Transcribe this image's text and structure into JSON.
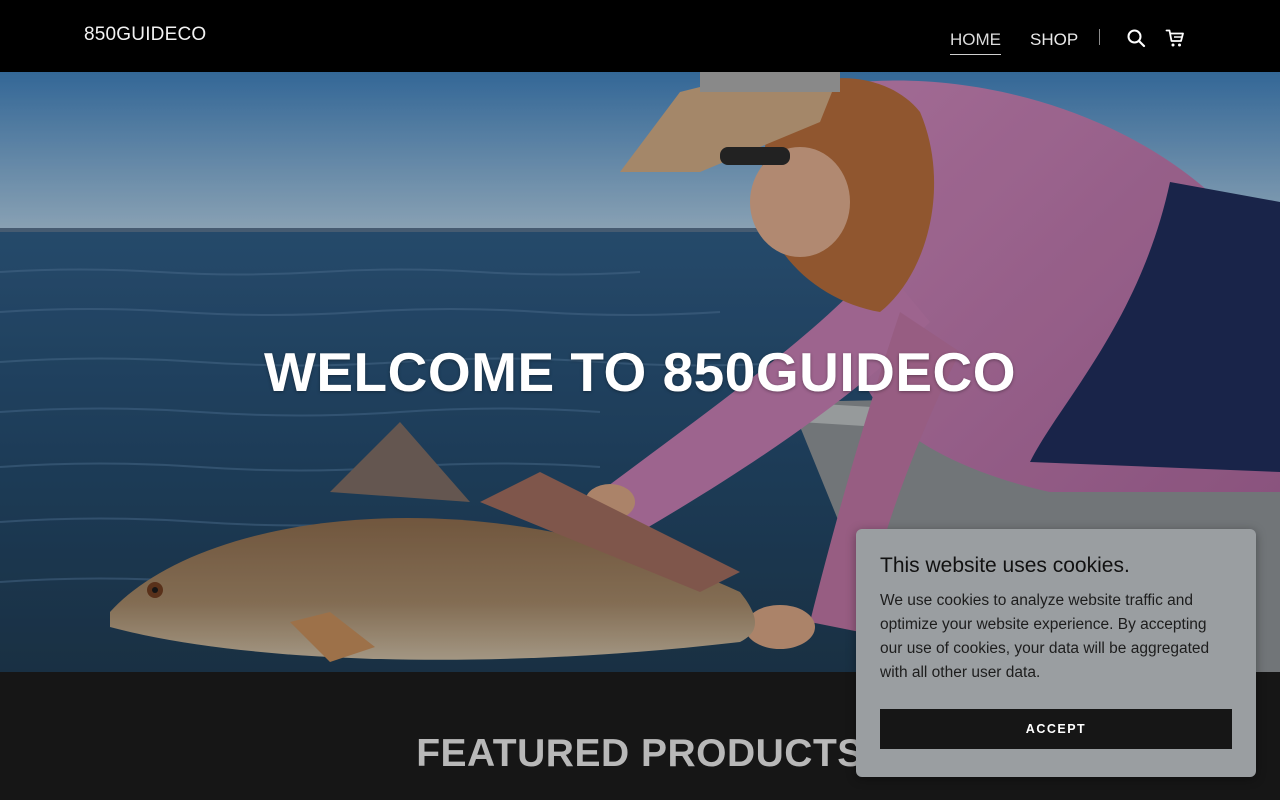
{
  "header": {
    "brand": "850GUIDECO",
    "nav": [
      {
        "label": "HOME",
        "active": true
      },
      {
        "label": "SHOP",
        "active": false
      }
    ],
    "icons": [
      "search-icon",
      "cart-icon"
    ]
  },
  "hero": {
    "title": "WELCOME TO 850GUIDECO"
  },
  "featured": {
    "title": "FEATURED PRODUCTS"
  },
  "cookie": {
    "title": "This website uses cookies.",
    "body": "We use cookies to analyze website traffic and optimize your website experience. By accepting our use of cookies, your data will be aggregated with all other user data.",
    "accept_label": "ACCEPT"
  },
  "colors": {
    "header_bg": "#000000",
    "section_bg": "#161616",
    "cookie_bg": "#9a9ea1",
    "button_bg": "#161616"
  }
}
